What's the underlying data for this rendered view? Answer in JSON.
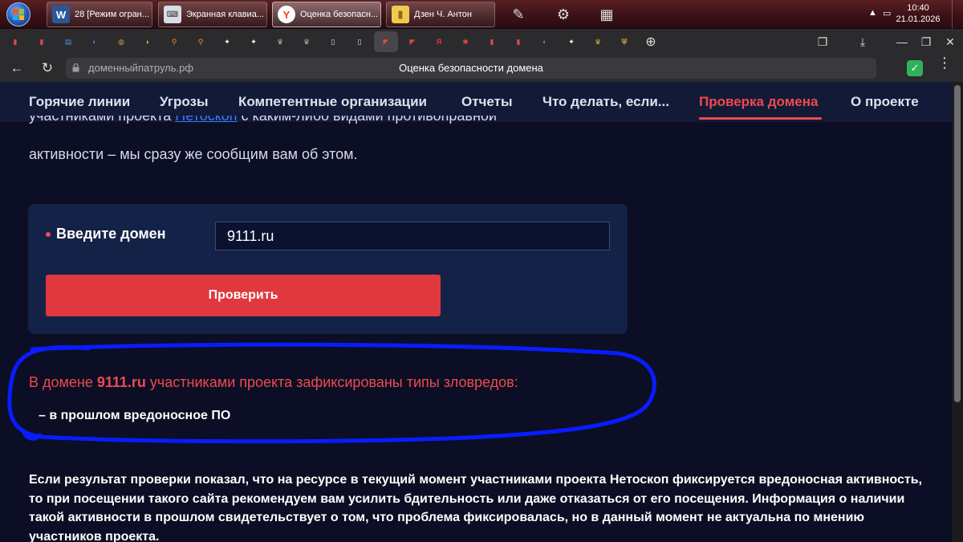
{
  "taskbar": {
    "tasks": [
      {
        "label": "28 [Режим огран...",
        "icon": "word-icon"
      },
      {
        "label": "Экранная клавиа...",
        "icon": "keyboard-icon"
      },
      {
        "label": "Оценка безопасн...",
        "icon": "yandex-browser-icon"
      },
      {
        "label": "Дзен Ч. Антон",
        "icon": "folder-icon"
      }
    ],
    "time": "10:40",
    "date": "21.01.2026"
  },
  "browser": {
    "url_host": "доменныйпатруль.рф",
    "page_title": "Оценка безопасности домена",
    "bookmarks": [
      {
        "icon": "pdf-icon",
        "color": "#e0483e"
      },
      {
        "icon": "pdf-icon",
        "color": "#e0483e"
      },
      {
        "icon": "page-icon",
        "color": "#4a8fd8"
      },
      {
        "icon": "edge-icon",
        "color": "#3a8fe8"
      },
      {
        "icon": "globe-icon",
        "color": "#c89050"
      },
      {
        "icon": "banana-icon",
        "color": "#f2c230"
      },
      {
        "icon": "search-icon",
        "color": "#f28c28"
      },
      {
        "icon": "search-icon",
        "color": "#f28c28"
      },
      {
        "icon": "sparkle-icon",
        "color": "#ffffff"
      },
      {
        "icon": "sparkle-icon",
        "color": "#ffffff"
      },
      {
        "icon": "emblem-icon",
        "color": "#b0b0b0"
      },
      {
        "icon": "emblem-icon",
        "color": "#b0b0b0"
      },
      {
        "icon": "document-icon",
        "color": "#dddddd"
      },
      {
        "icon": "document-icon",
        "color": "#dddddd"
      },
      {
        "icon": "flag-icon",
        "color": "#e0483e"
      },
      {
        "icon": "flag-icon",
        "color": "#e0483e"
      },
      {
        "icon": "yandex-icon",
        "color": "#e0383e"
      },
      {
        "icon": "leaf-icon",
        "color": "#e0483e"
      },
      {
        "icon": "pdf-icon",
        "color": "#e0483e"
      },
      {
        "icon": "pdf-icon",
        "color": "#e0483e"
      },
      {
        "icon": "edge-icon",
        "color": "#3a8fe8"
      },
      {
        "icon": "sparkle-icon",
        "color": "#ffffff"
      },
      {
        "icon": "emblem-icon",
        "color": "#d6a640"
      },
      {
        "icon": "shield-icon",
        "color": "#d6a640"
      }
    ]
  },
  "site_nav": {
    "items": [
      {
        "label": "Горячие линии",
        "active": false
      },
      {
        "label": "Угрозы",
        "active": false
      },
      {
        "label": "Компетентные организации",
        "active": false
      },
      {
        "label": "Отчеты",
        "active": false
      },
      {
        "label": "Что делать, если...",
        "active": false
      },
      {
        "label": "Проверка домена",
        "active": true
      },
      {
        "label": "О проекте",
        "active": false
      }
    ]
  },
  "intro": {
    "line1_prefix": "участниками проекта ",
    "line1_link": "Нетоскоп",
    "line1_suffix": "  с каким-либо видами противоправной",
    "line2": "активности – мы сразу же сообщим вам об этом."
  },
  "form": {
    "label": "Введите домен",
    "value": "9111.ru",
    "button": "Проверить"
  },
  "result": {
    "prefix": "В домене ",
    "domain": "9111.ru",
    "suffix": " участниками проекта зафиксированы типы зловредов:",
    "item": "– в прошлом вредоносное ПО",
    "highlight_color": "#0a1cff"
  },
  "footer_note": "Если результат проверки показал, что на ресурсе в текущий момент участниками проекта Нетоскоп фиксируется вредоносная активность, то при посещении такого сайта рекомендуем вам усилить бдительность или даже отказаться от его посещения. Информация о наличии такой активности в прошлом свидетельствует о том, что проблема фиксировалась, но в данный момент не актуальна по мнению участников проекта."
}
